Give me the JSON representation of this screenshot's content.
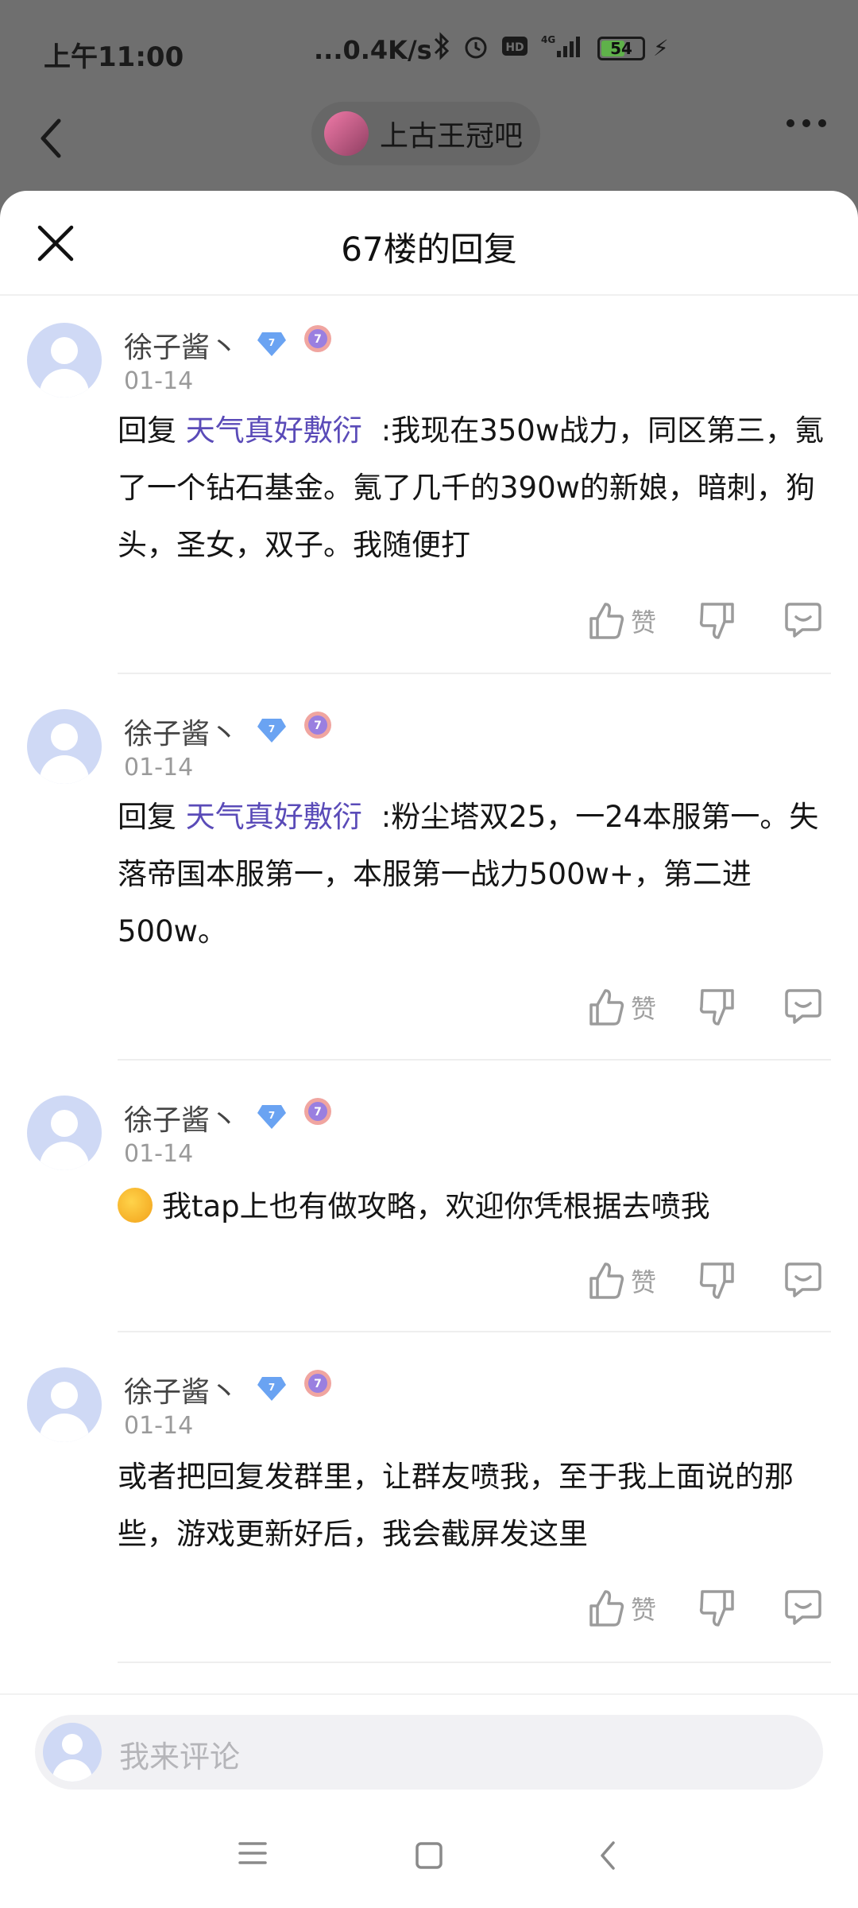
{
  "status_bar": {
    "time": "上午11:00",
    "network_speed": "...0.4K/s",
    "battery_level": "54",
    "battery_percent": 54
  },
  "top_bar": {
    "forum_name": "上古王冠吧"
  },
  "sheet": {
    "title": "67楼的回复",
    "replies": [
      {
        "username": "徐子酱丶",
        "level": "7",
        "date": "01-14",
        "prefix": "回复",
        "mention": "天气真好敷衍",
        "text": ":我现在350w战力，同区第三，氪了一个钻石基金。氪了几千的390w的新娘，暗刺，狗头，圣女，双子。我随便打",
        "like_label": "赞"
      },
      {
        "username": "徐子酱丶",
        "level": "7",
        "date": "01-14",
        "prefix": "回复",
        "mention": "天气真好敷衍",
        "text": ":粉尘塔双25，一24本服第一。失落帝国本服第一，本服第一战力500w+，第二进500w。",
        "like_label": "赞"
      },
      {
        "username": "徐子酱丶",
        "level": "7",
        "date": "01-14",
        "text": "我tap上也有做攻略，欢迎你凭根据去喷我",
        "like_label": "赞"
      },
      {
        "username": "徐子酱丶",
        "level": "7",
        "date": "01-14",
        "text": "或者把回复发群里，让群友喷我，至于我上面说的那些，游戏更新好后，我会截屏发这里",
        "like_label": "赞"
      }
    ]
  },
  "composer": {
    "placeholder": "我来评论"
  },
  "colors": {
    "mention": "#5a4bb8",
    "dim_overlay": "#6f6f6f",
    "avatar_bg": "#cfd9f5"
  }
}
